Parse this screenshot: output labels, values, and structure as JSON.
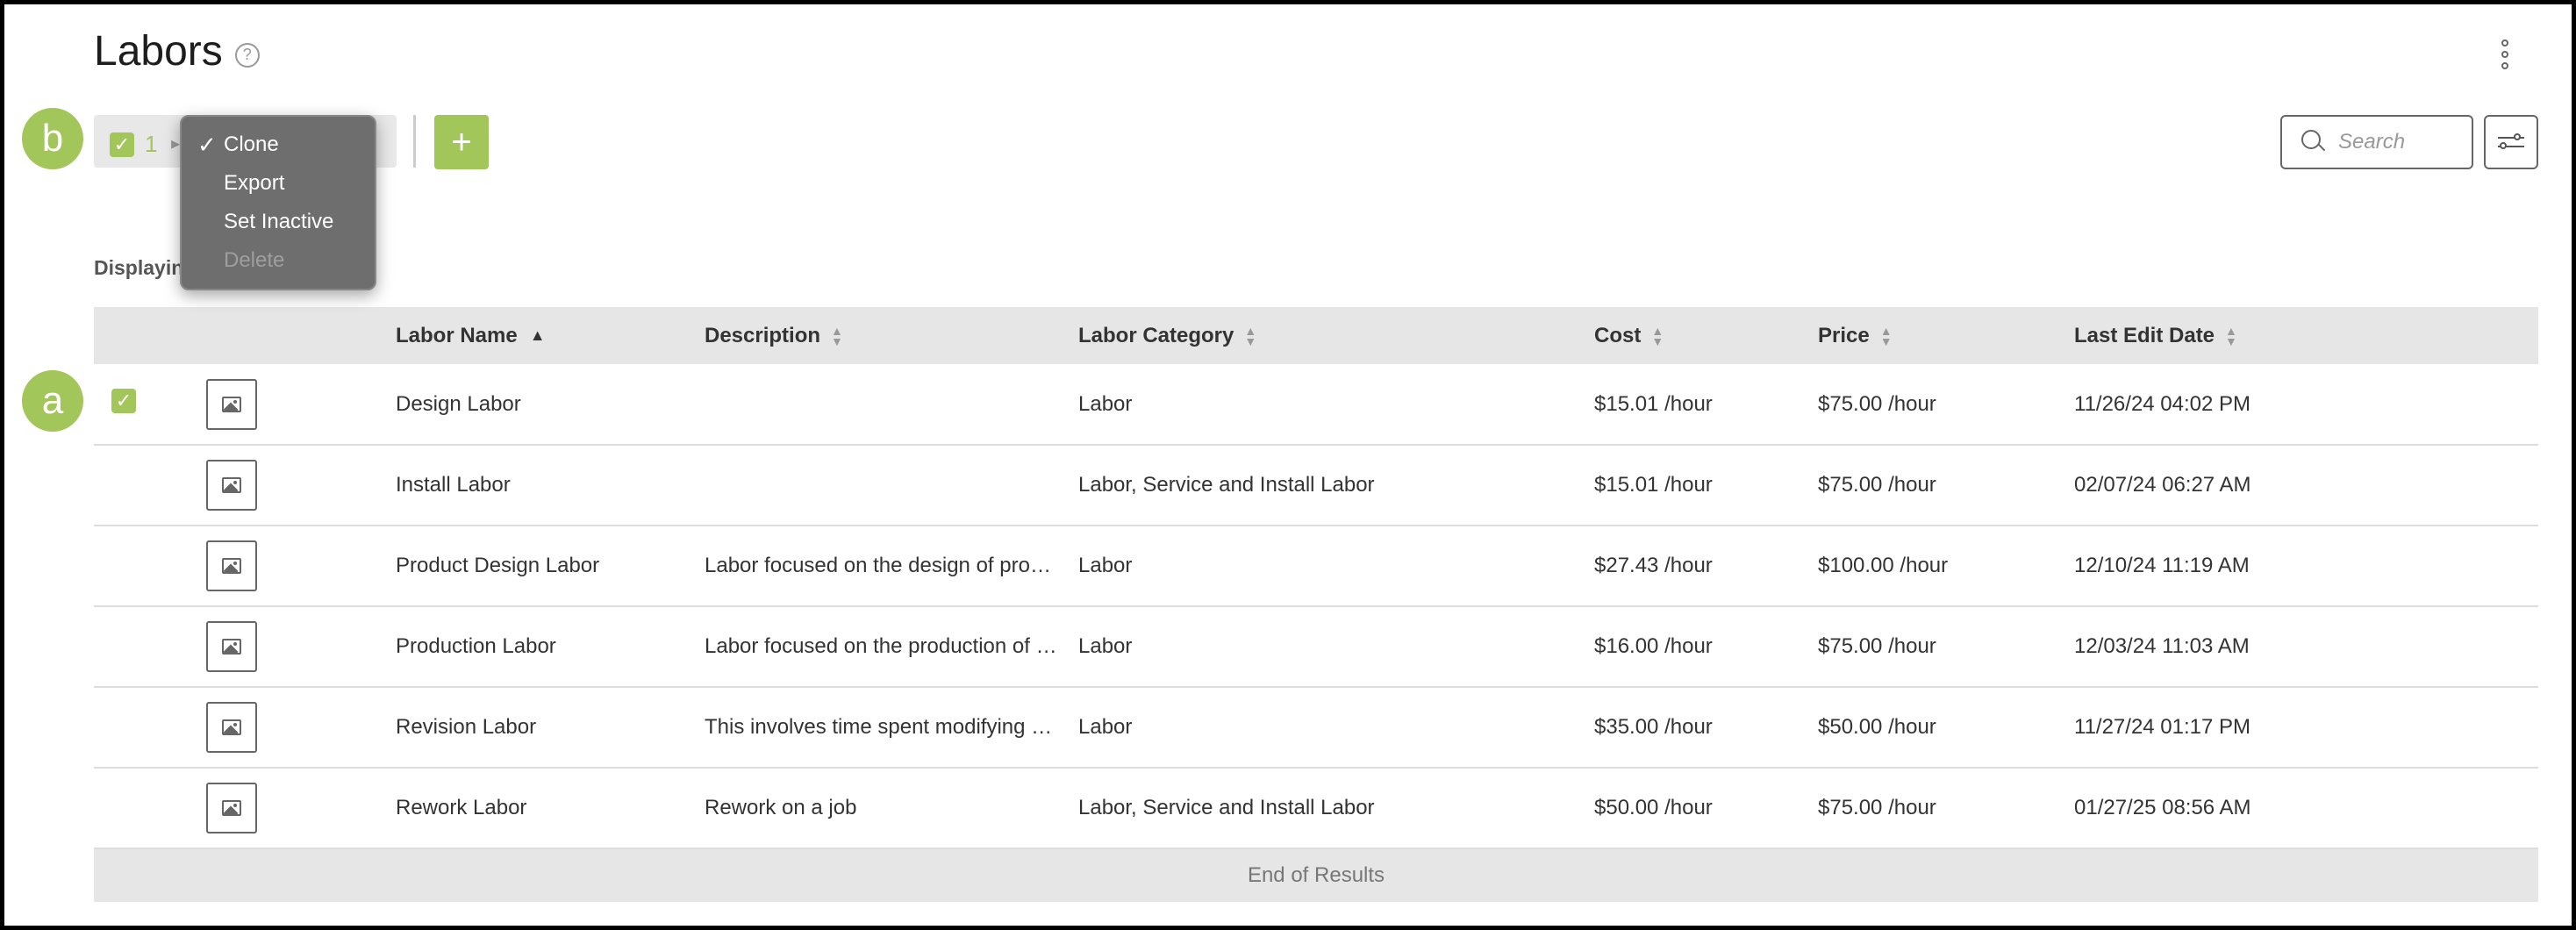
{
  "page": {
    "title": "Labors",
    "displaying_text": "Displayin"
  },
  "markers": {
    "a": "a",
    "b": "b"
  },
  "bulk": {
    "selected_count": "1"
  },
  "add_button": {
    "label": "+"
  },
  "dropdown": {
    "items": [
      {
        "label": "Clone",
        "checked": true,
        "disabled": false
      },
      {
        "label": "Export",
        "checked": false,
        "disabled": false
      },
      {
        "label": "Set Inactive",
        "checked": false,
        "disabled": false
      },
      {
        "label": "Delete",
        "checked": false,
        "disabled": true
      }
    ],
    "check_glyph": "✓"
  },
  "search": {
    "placeholder": "Search"
  },
  "table": {
    "columns": [
      "Labor Name",
      "Description",
      "Labor Category",
      "Cost",
      "Price",
      "Last Edit Date"
    ],
    "sorted_column": "Labor Name",
    "sort_direction": "asc",
    "rows": [
      {
        "selected": true,
        "name": "Design Labor",
        "description": "",
        "category": "Labor",
        "cost": "$15.01 /hour",
        "price": "$75.00 /hour",
        "date": "11/26/24 04:02 PM"
      },
      {
        "selected": false,
        "name": "Install Labor",
        "description": "",
        "category": "Labor, Service and Install Labor",
        "cost": "$15.01 /hour",
        "price": "$75.00 /hour",
        "date": "02/07/24 06:27 AM"
      },
      {
        "selected": false,
        "name": "Product Design Labor",
        "description": "Labor focused on the design of prod…",
        "category": "Labor",
        "cost": "$27.43 /hour",
        "price": "$100.00 /hour",
        "date": "12/10/24 11:19 AM"
      },
      {
        "selected": false,
        "name": "Production Labor",
        "description": "Labor focused on the production of …",
        "category": "Labor",
        "cost": "$16.00 /hour",
        "price": "$75.00 /hour",
        "date": "12/03/24 11:03 AM"
      },
      {
        "selected": false,
        "name": "Revision Labor",
        "description": "This involves time spent modifying …",
        "category": "Labor",
        "cost": "$35.00 /hour",
        "price": "$50.00 /hour",
        "date": "11/27/24 01:17 PM"
      },
      {
        "selected": false,
        "name": "Rework Labor",
        "description": "Rework on a job",
        "category": "Labor, Service and Install Labor",
        "cost": "$50.00 /hour",
        "price": "$75.00 /hour",
        "date": "01/27/25 08:56 AM"
      }
    ],
    "footer": "End of Results"
  },
  "colors": {
    "accent": "#a3c65a",
    "header_bg": "#e6e6e6",
    "menu_bg": "#6e6e6e"
  },
  "icons": [
    "help-icon",
    "kebab-menu-icon",
    "checkmark-icon",
    "plus-icon",
    "search-icon",
    "filter-sliders-icon",
    "image-placeholder-icon",
    "sort-icon"
  ]
}
